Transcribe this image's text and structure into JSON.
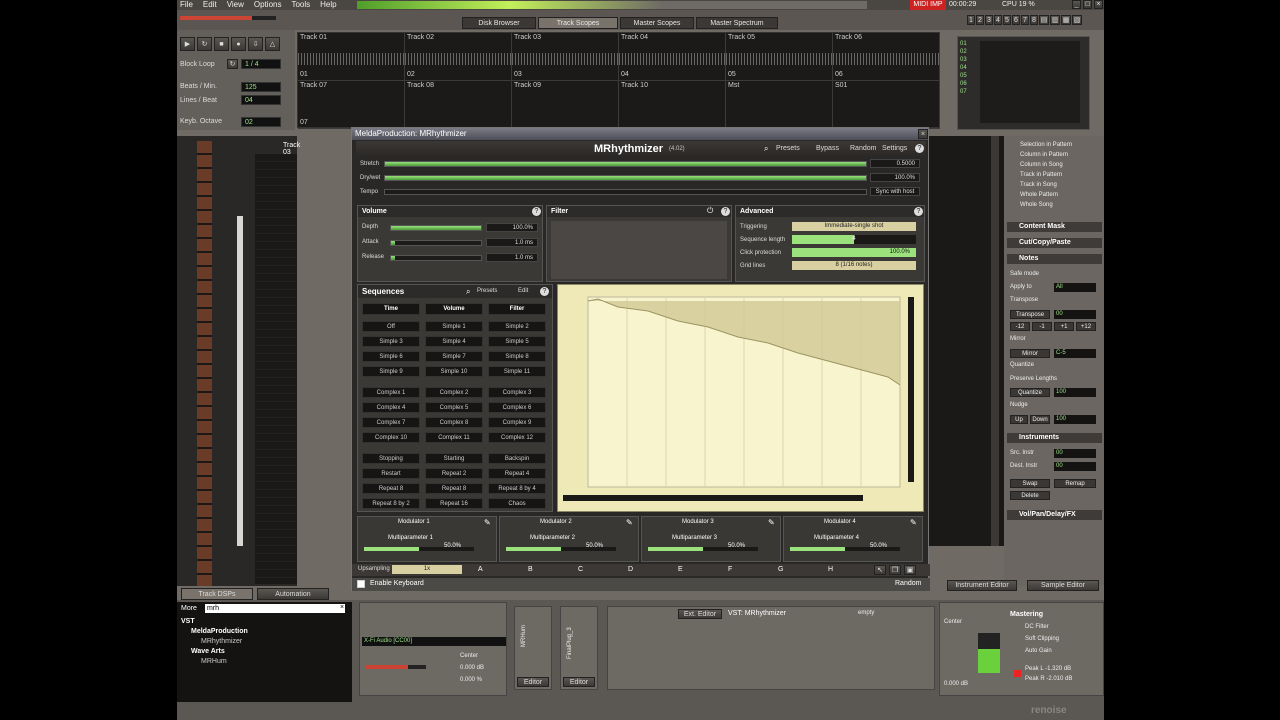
{
  "menu": [
    "File",
    "Edit",
    "View",
    "Options",
    "Tools",
    "Help"
  ],
  "top_tabs": [
    "Disk Browser",
    "Track Scopes",
    "Master Scopes",
    "Master Spectrum"
  ],
  "status": {
    "midi": "MIDI IMP",
    "time": "00:00:29",
    "cpu": "CPU 19 %"
  },
  "top_numbers": [
    "1",
    "2",
    "3",
    "4",
    "5",
    "6",
    "7",
    "8"
  ],
  "transport": {
    "block_loop": "Block Loop",
    "block_loop_val": "1 / 4",
    "bpm_label": "Beats / Min.",
    "bpm_val": "125",
    "lpb_label": "Lines / Beat",
    "lpb_val": "04",
    "keyb_label": "Keyb. Octave",
    "keyb_val": "02"
  },
  "tracks_row1": [
    {
      "name": "Track 01",
      "num": "01"
    },
    {
      "name": "Track 02",
      "num": "02"
    },
    {
      "name": "Track 03",
      "num": "03"
    },
    {
      "name": "Track 04",
      "num": "04"
    },
    {
      "name": "Track 05",
      "num": "05"
    },
    {
      "name": "Track 06",
      "num": "06"
    }
  ],
  "tracks_row2": [
    {
      "name": "Track 07",
      "num": "07"
    },
    {
      "name": "Track 08",
      "num": ""
    },
    {
      "name": "Track 09",
      "num": ""
    },
    {
      "name": "Track 10",
      "num": ""
    },
    {
      "name": "Mst",
      "num": ""
    },
    {
      "name": "S01",
      "num": ""
    }
  ],
  "track_list_right": [
    "01",
    "02",
    "03",
    "04",
    "05",
    "06",
    "07"
  ],
  "track03_header": "Track 03",
  "plugin": {
    "window_title": "MeldaProduction: MRhythmizer",
    "product": "MRhythmizer",
    "version": "(4.02)",
    "presets": "Presets",
    "bypass": "Bypass",
    "random": "Random",
    "settings": "Settings",
    "stretch_label": "Stretch",
    "stretch_val": "0.5000",
    "drywet_label": "Dry/wet",
    "drywet_val": "100.0%",
    "tempo_label": "Tempo",
    "tempo_val": "Sync with host",
    "volume": {
      "title": "Volume",
      "depth": "Depth",
      "depth_val": "100.0%",
      "attack": "Attack",
      "attack_val": "1.0 ms",
      "release": "Release",
      "release_val": "1.0 ms"
    },
    "filter": {
      "title": "Filter"
    },
    "advanced": {
      "title": "Advanced",
      "triggering": "Triggering",
      "triggering_val": "Immediate-single shot",
      "seqlen": "Sequence length",
      "seqlen_val": "4",
      "click": "Click protection",
      "click_val": "100.0%",
      "gridlines": "Grid lines",
      "gridlines_val": "8 (1/16 notes)"
    },
    "sequences": {
      "title": "Sequences",
      "presets": "Presets",
      "edit": "Edit",
      "headers": [
        "Time",
        "Volume",
        "Filter"
      ],
      "rows": [
        [
          "Off",
          "Simple 1",
          "Simple 2"
        ],
        [
          "Simple 3",
          "Simple 4",
          "Simple 5"
        ],
        [
          "Simple 6",
          "Simple 7",
          "Simple 8"
        ],
        [
          "Simple 9",
          "Simple 10",
          "Simple 11"
        ],
        [
          "Complex 1",
          "Complex 2",
          "Complex 3"
        ],
        [
          "Complex 4",
          "Complex 5",
          "Complex 6"
        ],
        [
          "Complex 7",
          "Complex 8",
          "Complex 9"
        ],
        [
          "Complex 10",
          "Complex 11",
          "Complex 12"
        ],
        [
          "Stopping",
          "Starting",
          "Backspin"
        ],
        [
          "Restart",
          "Repeat 2",
          "Repeat 4"
        ],
        [
          "Repeat 8",
          "Repeat 8",
          "Repeat 8 by 4"
        ],
        [
          "Repeat 8 by 2",
          "Repeat 16",
          "Chaos"
        ]
      ]
    },
    "modulators": [
      "Modulator 1",
      "Modulator 2",
      "Modulator 3",
      "Modulator 4"
    ],
    "multiparams": [
      {
        "label": "Multiparameter 1",
        "val": "50.0%"
      },
      {
        "label": "Multiparameter 2",
        "val": "50.0%"
      },
      {
        "label": "Multiparameter 3",
        "val": "50.0%"
      },
      {
        "label": "Multiparameter 4",
        "val": "50.0%"
      }
    ],
    "upsampling": "Upsampling",
    "upsampling_val": "1x",
    "letters": [
      "A",
      "B",
      "C",
      "D",
      "E",
      "F",
      "G",
      "H"
    ],
    "enable_keyboard": "Enable Keyboard",
    "random_btn": "Random"
  },
  "right_panel": {
    "scope": [
      "Selection in Pattern",
      "Column in Pattern",
      "Column in Song",
      "Track in Pattern",
      "Track in Song",
      "Whole Pattern",
      "Whole Song"
    ],
    "content_mask": "Content Mask",
    "cut_copy": "Cut/Copy/Paste",
    "notes": "Notes",
    "safe_mode": "Safe mode",
    "apply_to": "Apply to",
    "apply_val": "All",
    "transpose_title": "Transpose",
    "transpose": "Transpose",
    "transpose_val": "00",
    "transpose_btns": [
      "-12",
      "-1",
      "+1",
      "+12"
    ],
    "mirror_title": "Mirror",
    "mirror": "Mirror",
    "mirror_val": "C-5",
    "quantize_title": "Quantize",
    "preserve": "Preserve Lengths",
    "quantize": "Quantize",
    "quantize_val": "100",
    "nudge_title": "Nudge",
    "up": "Up",
    "down": "Down",
    "nudge_val": "100",
    "instruments": "Instruments",
    "src_instr": "Src. Instr",
    "src_val": "00",
    "dest_instr": "Dest. Instr",
    "dest_val": "00",
    "swap": "Swap",
    "remap": "Remap",
    "delete": "Delete",
    "volpan": "Vol/Pan/Delay/FX",
    "instrument_editor": "Instrument Editor",
    "sample_editor": "Sample Editor"
  },
  "bottom": {
    "tabs": [
      "Track DSPs",
      "Automation"
    ],
    "browser_label": "More",
    "browser_search": "mrh",
    "tree": [
      {
        "l": "VST",
        "i": 0
      },
      {
        "l": "MeldaProduction",
        "i": 1
      },
      {
        "l": "MRhythmizer",
        "i": 2
      },
      {
        "l": "Wave Arts",
        "i": 1
      },
      {
        "l": "MRHum",
        "i": 2
      }
    ],
    "device": "X-Fi Audio [CC00]",
    "center": "Center",
    "db": "0.000 dB",
    "pct": "0.000 %",
    "editor1": "Editor",
    "editor2": "Editor",
    "ext_editor": "Ext. Editor",
    "vst": "VST: MRhythmizer",
    "empty": "empty",
    "vert1": "MRHum",
    "vert2": "FinalPlug_3",
    "master_center": "Center",
    "master_db": "0.000 dB",
    "mastering": "Mastering",
    "dc_filter": "DC Filter",
    "soft_clip": "Soft Clipping",
    "auto_gain": "Auto Gain",
    "peak_l": "Peak L -1.320 dB",
    "peak_r": "Peak R -2.010 dB"
  },
  "brand": "renoise"
}
